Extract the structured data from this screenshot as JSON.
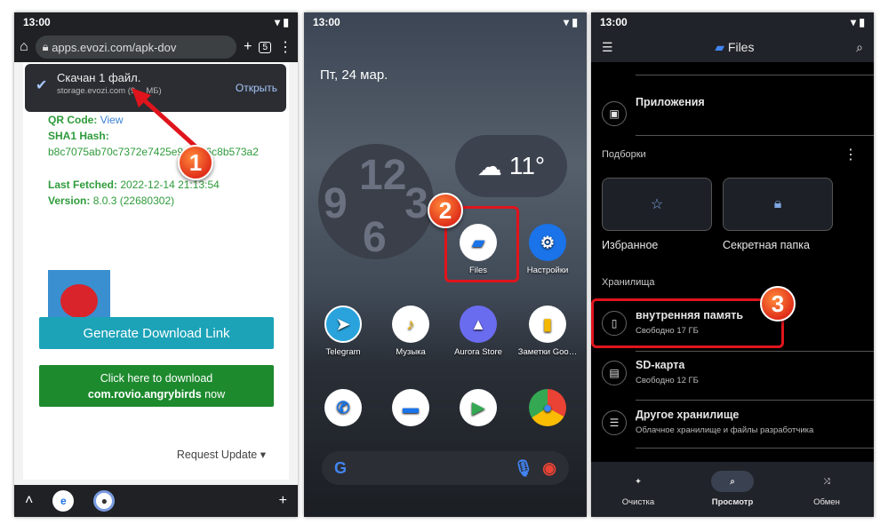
{
  "status_time": "13:00",
  "browser": {
    "url": "apps.evozi.com/apk-dov",
    "tab_count": "5",
    "toast": {
      "title": "Скачан 1 файл.",
      "subtitle": "storage.evozi.com (9… МБ)",
      "action": "Открыть"
    },
    "qr_label": "QR Code:",
    "qr_link": "View",
    "sha_label": "SHA1 Hash:",
    "sha_value": "b8c7075ab70c7372e7425e9…b56c8b573a2",
    "fetched_label": "Last Fetched:",
    "fetched_value": "2022-12-14 21:13:54",
    "version_label": "Version:",
    "version_value": "8.0.3 (22680302)",
    "generate_button": "Generate Download Link",
    "download_line1": "Click here to download",
    "download_package": "com.rovio.angrybirds",
    "download_suffix": " now",
    "request_update": "Request Update"
  },
  "home": {
    "date": "Пт, 24 мар.",
    "temperature": "11°",
    "apps": [
      {
        "label": "Files",
        "icon": "files-icon"
      },
      {
        "label": "Настройки",
        "icon": "settings-icon"
      },
      {
        "label": "Telegram",
        "icon": "telegram-icon"
      },
      {
        "label": "Музыка",
        "icon": "music-icon"
      },
      {
        "label": "Aurora Store",
        "icon": "aurora-store-icon"
      },
      {
        "label": "Заметки Goo…",
        "icon": "keep-notes-icon"
      }
    ],
    "dock": [
      "phone-icon",
      "messages-icon",
      "play-store-icon",
      "chrome-icon"
    ]
  },
  "files": {
    "title": "Files",
    "apps_item": "Приложения",
    "collections_header": "Подборки",
    "favorites": "Избранное",
    "secret_folder": "Секретная папка",
    "storage_header": "Хранилища",
    "storage": [
      {
        "title": "внутренняя память",
        "subtitle": "Свободно 17 ГБ"
      },
      {
        "title": "SD-карта",
        "subtitle": "Свободно 12 ГБ"
      },
      {
        "title": "Другое хранилище",
        "subtitle": "Облачное хранилище и файлы разработчика"
      }
    ],
    "nav": [
      {
        "label": "Очистка"
      },
      {
        "label": "Просмотр"
      },
      {
        "label": "Обмен"
      }
    ]
  },
  "steps": [
    "1",
    "2",
    "3"
  ],
  "colors": {
    "highlight": "#e0141c",
    "badge": "#e0301a"
  }
}
